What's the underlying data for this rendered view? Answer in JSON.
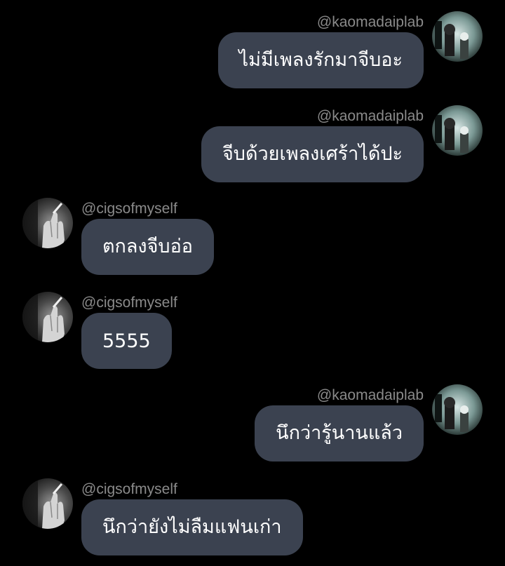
{
  "users": {
    "right": "@kaomadaiplab",
    "left": "@cigsofmyself"
  },
  "messages": [
    {
      "side": "right",
      "username": "@kaomadaiplab",
      "text": "ไม่มีเพลงรักมาจีบอะ",
      "avatar": "photo-avatar-icon"
    },
    {
      "side": "right",
      "username": "@kaomadaiplab",
      "text": "จีบด้วยเพลงเศร้าได้ปะ",
      "avatar": "photo-avatar-icon"
    },
    {
      "side": "left",
      "username": "@cigsofmyself",
      "text": "ตกลงจีบอ่อ",
      "avatar": "hand-cigarette-avatar-icon"
    },
    {
      "side": "left",
      "username": "@cigsofmyself",
      "text": "5555",
      "avatar": "hand-cigarette-avatar-icon"
    },
    {
      "side": "right",
      "username": "@kaomadaiplab",
      "text": "นึกว่ารู้นานแล้ว",
      "avatar": "photo-avatar-icon"
    },
    {
      "side": "left",
      "username": "@cigsofmyself",
      "text": "นึกว่ายังไม่ลืมแฟนเก่า",
      "avatar": "hand-cigarette-avatar-icon"
    }
  ],
  "colors": {
    "background": "#000000",
    "bubble": "#3b4250",
    "username": "#8a8a8a",
    "text": "#ffffff"
  }
}
